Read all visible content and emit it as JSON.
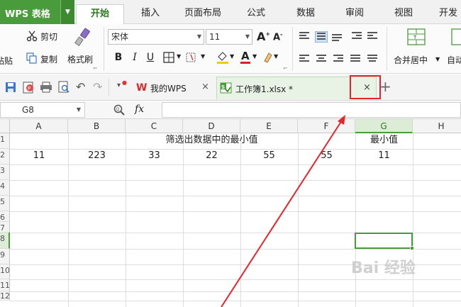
{
  "app": {
    "name": "WPS 表格"
  },
  "menu": {
    "tabs": [
      "开始",
      "插入",
      "页面布局",
      "公式",
      "数据",
      "审阅",
      "视图",
      "开发工"
    ],
    "active_index": 0
  },
  "ribbon": {
    "paste_label": "粘贴",
    "cut_label": "剪切",
    "copy_label": "复制",
    "format_painter_label": "格式刷",
    "font_name": "宋体",
    "font_size": "11",
    "bold": "B",
    "italic": "I",
    "underline": "U",
    "merge_center_label": "合并居中",
    "auto_wrap_label": "自动"
  },
  "doc_tabs": [
    {
      "label": "我的WPS",
      "active": false
    },
    {
      "label": "工作簿1.xlsx *",
      "active": true
    }
  ],
  "formula_bar": {
    "name_box": "G8",
    "fx": "fx",
    "value": ""
  },
  "sheet": {
    "columns": [
      "A",
      "B",
      "C",
      "D",
      "E",
      "F",
      "G",
      "H"
    ],
    "selected_column": "G",
    "rows": [
      "1",
      "2",
      "3",
      "4",
      "5",
      "6",
      "7",
      "8",
      "9",
      "10",
      "11",
      "12"
    ],
    "selected_row": "8",
    "header_text": "筛选出数据中的最小值",
    "min_header": "最小值",
    "values": [
      "11",
      "223",
      "33",
      "22",
      "55",
      "55"
    ],
    "min_value": "11"
  },
  "watermark": "Bai 经验",
  "colors": {
    "accent": "#4a9b3c",
    "highlight": "#e8242b"
  }
}
